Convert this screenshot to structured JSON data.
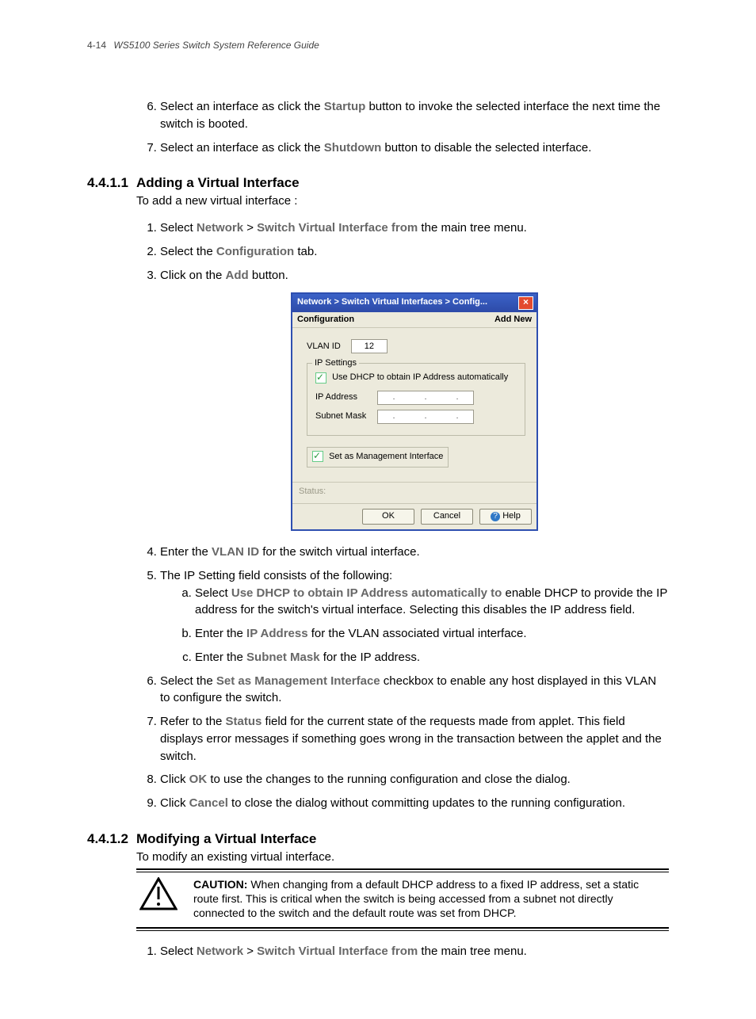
{
  "header": {
    "page_num": "4-14",
    "title": "WS5100 Series Switch System Reference Guide"
  },
  "pre_list": {
    "item6": {
      "prefix": "Select an interface as click the ",
      "bold": "Startup",
      "suffix": " button to invoke the selected interface the next time the switch is booted."
    },
    "item7": {
      "prefix": "Select an interface as click the ",
      "bold": "Shutdown",
      "suffix": " button to disable the selected interface."
    }
  },
  "section1": {
    "num": "4.4.1.1",
    "title": "Adding a Virtual Interface",
    "intro": "To add a new virtual interface :",
    "steps": {
      "s1": {
        "a": "Select ",
        "b": "Network",
        "c": " > ",
        "d": "Switch Virtual Interface from",
        "e": " the main tree menu."
      },
      "s2": {
        "a": "Select the ",
        "b": "Configuration",
        "c": " tab."
      },
      "s3": {
        "a": "Click on the ",
        "b": "Add",
        "c": " button."
      },
      "s4": {
        "a": "Enter the ",
        "b": "VLAN ID",
        "c": " for the switch virtual interface."
      },
      "s5": {
        "a": "The IP Setting field consists of the following:"
      },
      "s5a": {
        "a": "Select ",
        "b": "Use DHCP to obtain IP Address automatically to",
        "c": " enable DHCP to provide the IP address for the switch's virtual interface. Selecting this disables the IP address field."
      },
      "s5b": {
        "a": "Enter the ",
        "b": "IP Address",
        "c": " for the VLAN associated virtual interface."
      },
      "s5c": {
        "a": "Enter the ",
        "b": "Subnet Mask",
        "c": " for the IP address."
      },
      "s6": {
        "a": "Select the ",
        "b": "Set as Management Interface",
        "c": " checkbox to enable any host displayed in this VLAN to configure the switch."
      },
      "s7": {
        "a": "Refer to the ",
        "b": "Status",
        "c": " field for the current state of the requests made from applet. This field displays error messages if something goes wrong in the transaction between the applet and the switch."
      },
      "s8": {
        "a": "Click ",
        "b": "OK",
        "c": " to use the changes to the running configuration and close the dialog."
      },
      "s9": {
        "a": "Click ",
        "b": "Cancel",
        "c": " to close the dialog without committing updates to the running configuration."
      }
    }
  },
  "dialog": {
    "title": "Network > Switch Virtual Interfaces > Config...",
    "sub_left": "Configuration",
    "sub_right": "Add New",
    "vlan_label": "VLAN ID",
    "vlan_value": "12",
    "ipset_legend": "IP Settings",
    "dhcp_label": "Use DHCP to obtain IP Address automatically",
    "ipaddr_label": "IP Address",
    "subnet_label": "Subnet Mask",
    "mgmt_label": "Set as Management Interface",
    "status_label": "Status:",
    "btn_ok": "OK",
    "btn_cancel": "Cancel",
    "btn_help": "Help"
  },
  "section2": {
    "num": "4.4.1.2",
    "title": "Modifying a Virtual Interface",
    "intro": "To modify an existing virtual interface.",
    "caution_label": "CAUTION:",
    "caution_text": " When changing from a default DHCP address to a fixed IP address, set a static route first. This is critical when the switch is being accessed from a subnet not directly connected to the switch and the default route was set from DHCP.",
    "s1": {
      "a": "Select ",
      "b": "Network",
      "c": " > ",
      "d": "Switch Virtual Interface from",
      "e": " the main tree menu."
    }
  }
}
